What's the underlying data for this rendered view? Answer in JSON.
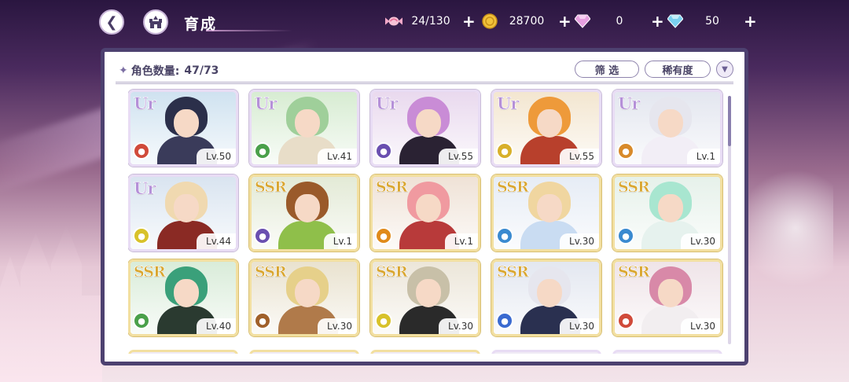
{
  "header": {
    "title": "育成",
    "back_icon": "back-arrow-icon",
    "home_icon": "castle-home-icon"
  },
  "resources": [
    {
      "name": "candy",
      "icon": "candy-icon",
      "value": "24/130"
    },
    {
      "name": "gold",
      "icon": "gold-coin-icon",
      "value": "28700"
    },
    {
      "name": "pink-gem",
      "icon": "pink-diamond-icon",
      "value": "0"
    },
    {
      "name": "blue-gem",
      "icon": "blue-diamond-icon",
      "value": "50"
    }
  ],
  "panel": {
    "count_label": "角色数量:",
    "count_value": "47/73",
    "filter_label": "筛 选",
    "rarity_label": "稀有度",
    "sort_icon": "sort-toggle-icon"
  },
  "colors": {
    "panel_border": "#4d4170",
    "ur_frame": "#e8dcf4",
    "ssr_frame": "#f2dfa0"
  },
  "characters": [
    {
      "rarity": "UR",
      "level": "Lv.50",
      "attr_color": "#d04a3a",
      "hair": "#2b2f4a",
      "outfit": "#3a3b5a",
      "bg": "#cfe2f0"
    },
    {
      "rarity": "UR",
      "level": "Lv.41",
      "attr_color": "#4aa04a",
      "hair": "#9fcf9a",
      "outfit": "#e8ddc8",
      "bg": "#d7ecd2"
    },
    {
      "rarity": "UR",
      "level": "Lv.55",
      "attr_color": "#6a4fb0",
      "hair": "#c98cd6",
      "outfit": "#2a2233",
      "bg": "#e9d9ee"
    },
    {
      "rarity": "UR",
      "level": "Lv.55",
      "attr_color": "#d8b02a",
      "hair": "#ee9a3a",
      "outfit": "#b8402c",
      "bg": "#f3e6d0"
    },
    {
      "rarity": "UR",
      "level": "Lv.1",
      "attr_color": "#d88a2a",
      "hair": "#e6e6ee",
      "outfit": "#f2eef6",
      "bg": "#e3e6ef"
    },
    {
      "rarity": "UR",
      "level": "Lv.44",
      "attr_color": "#d8c22a",
      "hair": "#f0d9b0",
      "outfit": "#8a2a24",
      "bg": "#d9e4f0"
    },
    {
      "rarity": "SSR",
      "level": "Lv.1",
      "attr_color": "#6a4fb0",
      "hair": "#9a5a2a",
      "outfit": "#8fbf4a",
      "bg": "#e3ead6"
    },
    {
      "rarity": "SSR",
      "level": "Lv.1",
      "attr_color": "#e08a1a",
      "hair": "#f09aa0",
      "outfit": "#b83a3a",
      "bg": "#efe2d6"
    },
    {
      "rarity": "SSR",
      "level": "Lv.30",
      "attr_color": "#3a8ad0",
      "hair": "#f0d6a0",
      "outfit": "#c9dcf2",
      "bg": "#e6ecf5"
    },
    {
      "rarity": "SSR",
      "level": "Lv.30",
      "attr_color": "#3a8ad0",
      "hair": "#a8e6d0",
      "outfit": "#e6f2ee",
      "bg": "#e6f1ea"
    },
    {
      "rarity": "SSR",
      "level": "Lv.40",
      "attr_color": "#4aa04a",
      "hair": "#3aa07a",
      "outfit": "#2a3a30",
      "bg": "#d9ecd9"
    },
    {
      "rarity": "SSR",
      "level": "Lv.30",
      "attr_color": "#a0602a",
      "hair": "#e6d08a",
      "outfit": "#b07a4a",
      "bg": "#e9e2cf"
    },
    {
      "rarity": "SSR",
      "level": "Lv.30",
      "attr_color": "#d8c22a",
      "hair": "#c8c0a8",
      "outfit": "#2a2a2a",
      "bg": "#ece6d9"
    },
    {
      "rarity": "SSR",
      "level": "Lv.30",
      "attr_color": "#3a6ad0",
      "hair": "#e6e6ee",
      "outfit": "#2a3050",
      "bg": "#e3e7f0"
    },
    {
      "rarity": "SSR",
      "level": "Lv.30",
      "attr_color": "#d04a3a",
      "hair": "#d889a8",
      "outfit": "#f2eef0",
      "bg": "#efe4e8"
    }
  ]
}
